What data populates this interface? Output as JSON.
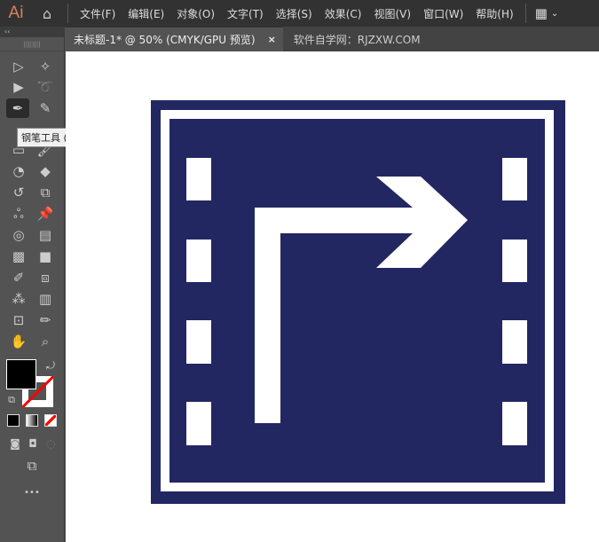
{
  "app": {
    "logo": "Ai"
  },
  "menu": [
    "文件(F)",
    "编辑(E)",
    "对象(O)",
    "文字(T)",
    "选择(S)",
    "效果(C)",
    "视图(V)",
    "窗口(W)",
    "帮助(H)"
  ],
  "tabs": {
    "active": "未标题-1* @ 50% (CMYK/GPU 预览)",
    "close": "×",
    "other": "软件自学网：RJZXW.COM"
  },
  "toolbar": {
    "collapse": "‹‹",
    "tooltip": "钢笔工具 (P)",
    "active_tool": "pen-tool"
  },
  "colors": {
    "sign_blue": "#222762",
    "sign_white": "#ffffff",
    "fill": "#000000",
    "stroke": "none"
  },
  "more": "•••"
}
